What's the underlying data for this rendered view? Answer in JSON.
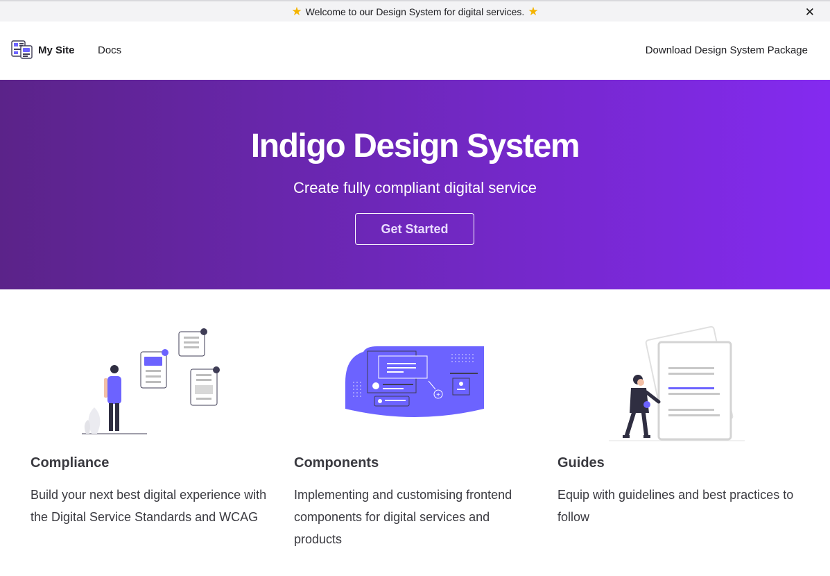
{
  "banner": {
    "message": "Welcome to our Design System for digital services.",
    "star_icon": "star-icon",
    "close_glyph": "✕"
  },
  "header": {
    "site_name": "My Site",
    "nav_docs": "Docs",
    "nav_download": "Download Design System Package"
  },
  "hero": {
    "title": "Indigo Design System",
    "subtitle": "Create fully compliant digital service",
    "cta_label": "Get Started"
  },
  "features": [
    {
      "title": "Compliance",
      "description": "Build your next best digital experience with the Digital Service Standards and WCAG"
    },
    {
      "title": "Components",
      "description": "Implementing and customising frontend components for digital services and products"
    },
    {
      "title": "Guides",
      "description": "Equip with guidelines and best practices to follow"
    }
  ],
  "colors": {
    "accent": "#6c63ff",
    "hero_start": "#5b2389",
    "hero_end": "#842af0"
  }
}
